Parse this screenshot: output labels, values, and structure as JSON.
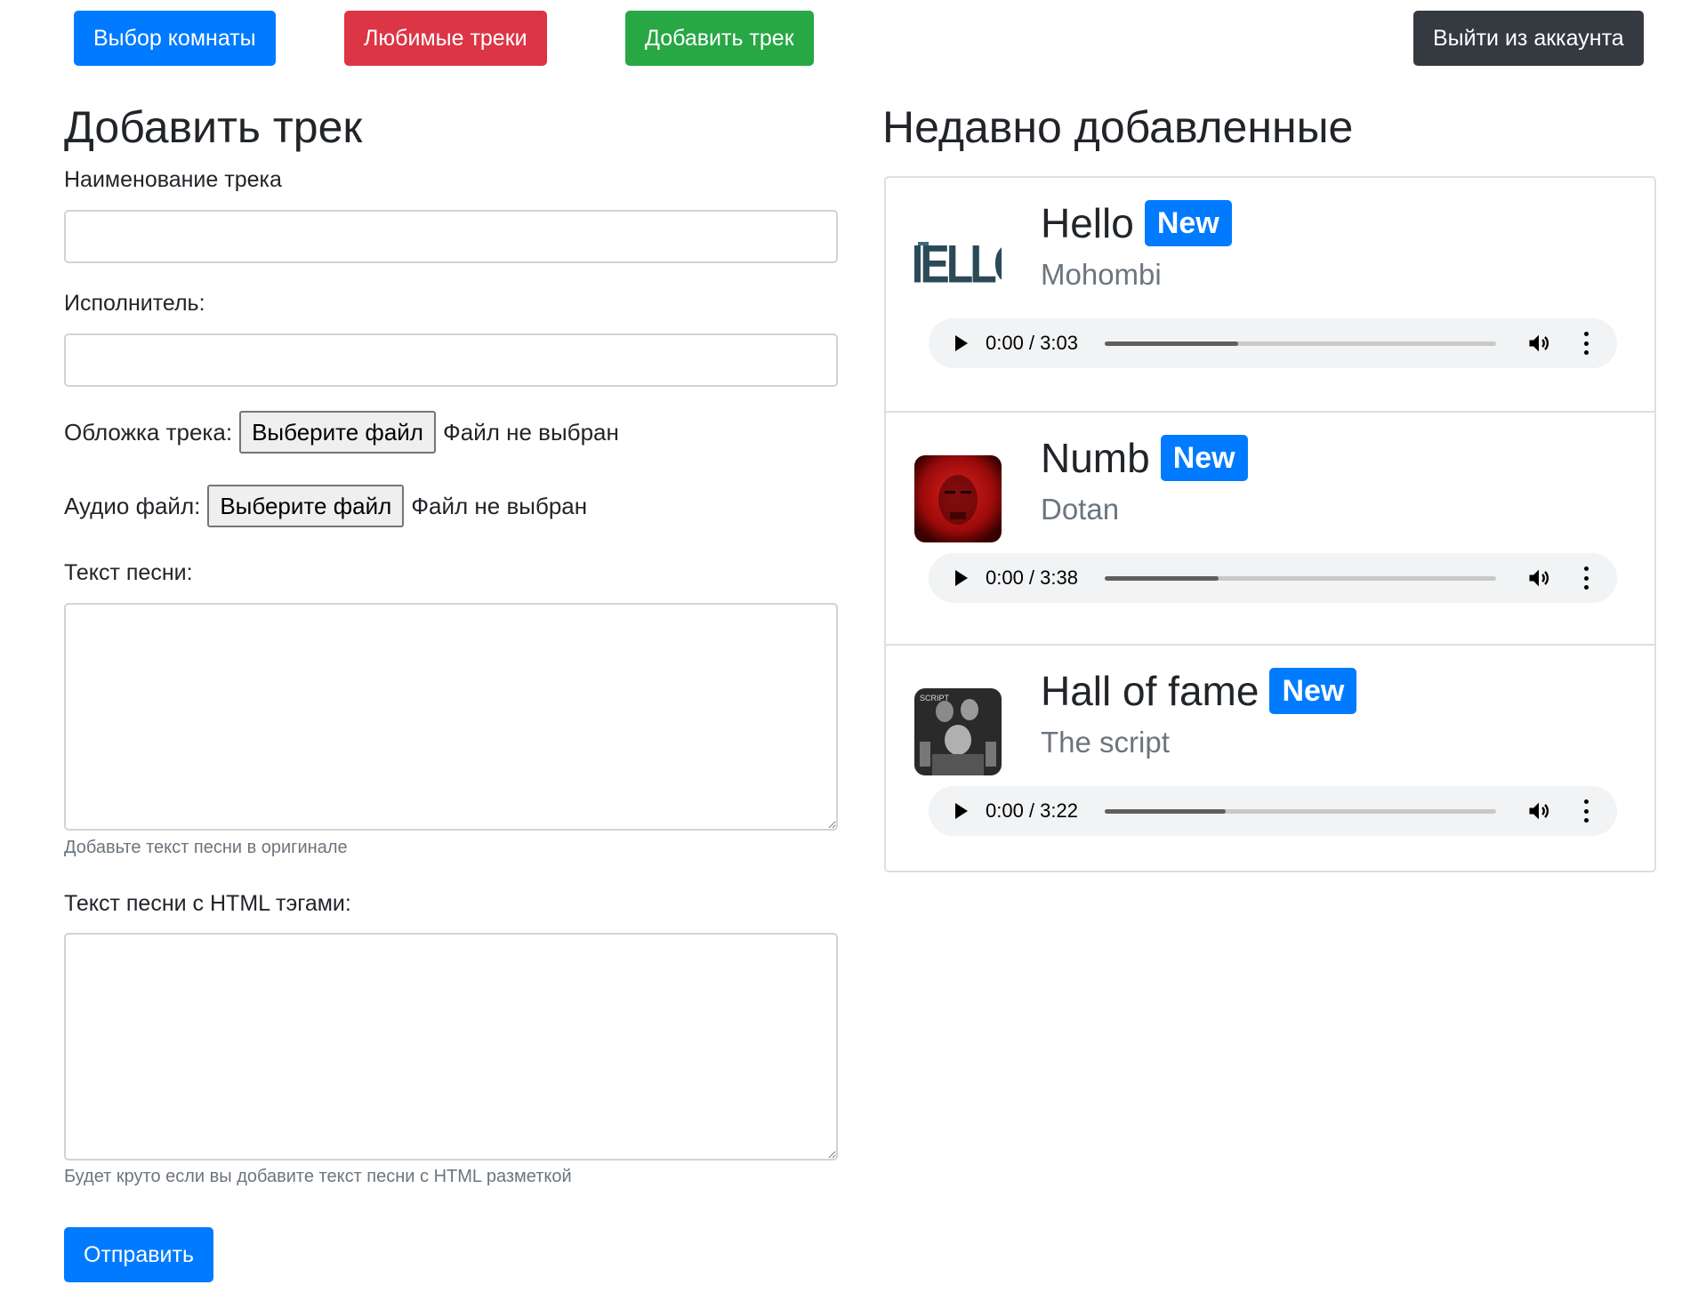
{
  "nav": {
    "room_select": "Выбор комнаты",
    "favorites": "Любимые треки",
    "add_track": "Добавить трек",
    "logout": "Выйти из аккаунта"
  },
  "form": {
    "heading": "Добавить трек",
    "track_name_label": "Наименование трека",
    "track_name_value": "",
    "artist_label": "Исполнитель:",
    "artist_value": "",
    "cover_label": "Обложка трека:",
    "cover_button": "Выберите файл",
    "cover_status": "Файл не выбран",
    "audio_label": "Аудио файл:",
    "audio_button": "Выберите файл",
    "audio_status": "Файл не выбран",
    "lyrics_label": "Текст песни:",
    "lyrics_help": "Добавьте текст песни в оригинале",
    "lyrics_html_label": "Текст песни с HTML тэгами:",
    "lyrics_html_help": "Будет круто если вы добавите текст песни с HTML разметкой",
    "submit": "Отправить"
  },
  "recent": {
    "heading": "Недавно добавленные",
    "badge": "New",
    "tracks": [
      {
        "title": "Hello",
        "artist": "Mohombi",
        "time": "0:00 / 3:03",
        "loaded": 0.34
      },
      {
        "title": "Numb",
        "artist": "Dotan",
        "time": "0:00 / 3:38",
        "loaded": 0.29
      },
      {
        "title": "Hall of fame",
        "artist": "The script",
        "time": "0:00 / 3:22",
        "loaded": 0.31
      }
    ]
  },
  "colors": {
    "primary": "#007bff",
    "danger": "#dc3545",
    "success": "#28a745",
    "dark": "#343a40",
    "muted": "#6c757d"
  }
}
